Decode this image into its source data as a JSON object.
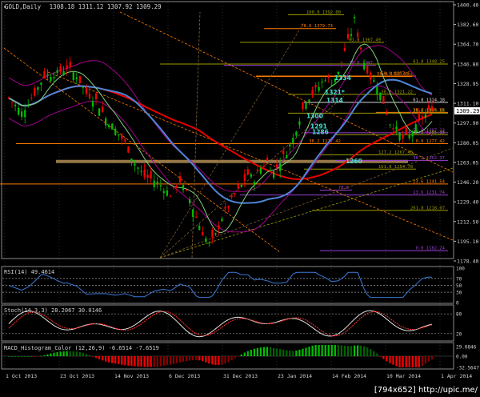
{
  "header": {
    "symbol": "GOLD,Daily",
    "ohlc": "1308.18 1311.12 1307.92 1309.29"
  },
  "colors": {
    "bg": "#000000",
    "grid": "#2a2a2a",
    "axis": "#bfbfbf",
    "text": "#d0d0d0",
    "bull": "#00c000",
    "bear": "#ff0000",
    "wick": "#bfbfbf",
    "ma_red": "#e80000",
    "ma_blue": "#4f86d6",
    "ma_green": "#7fd07f",
    "bollinger": "#b0009a",
    "fib_grey": "#d8d8d8",
    "fib_olive": "#9a9a00",
    "fib_violet": "#9b3fd8",
    "fib_orange": "#ff7b00",
    "cyan": "#40e0d0",
    "sr_band": "#c8a060",
    "price_label_bg": "#ffffff"
  },
  "chart_data": {
    "type": "candlestick",
    "price_axis_ticks": [
      "1400.40",
      "1382.60",
      "1364.70",
      "1346.80",
      "1328.95",
      "1311.10",
      "1297.90",
      "1280.05",
      "1263.05",
      "1246.20",
      "1229.40",
      "1212.50",
      "1195.10",
      "1178.40"
    ],
    "current_price": "1309.29",
    "price_range": [
      1176.0,
      1403.0
    ],
    "date_axis_labels": [
      "1 Oct 2013",
      "23 Oct 2013",
      "14 Nov 2013",
      "6 Dec 2013",
      "31 Dec 2013",
      "23 Jan 2014",
      "14 Feb 2014",
      "10 Mar 2014",
      "1 Apr 2014"
    ],
    "bar_count": 132,
    "candles_close_path": [
      [
        0,
        1318
      ],
      [
        4,
        1305
      ],
      [
        8,
        1322
      ],
      [
        11,
        1338
      ],
      [
        15,
        1340
      ],
      [
        18,
        1345
      ],
      [
        21,
        1338
      ],
      [
        24,
        1322
      ],
      [
        27,
        1316
      ],
      [
        30,
        1300
      ],
      [
        33,
        1290
      ],
      [
        36,
        1278
      ],
      [
        39,
        1260
      ],
      [
        42,
        1248
      ],
      [
        45,
        1245
      ],
      [
        48,
        1238
      ],
      [
        50,
        1232
      ],
      [
        53,
        1244
      ],
      [
        56,
        1228
      ],
      [
        58,
        1212
      ],
      [
        60,
        1198
      ],
      [
        62,
        1188
      ],
      [
        64,
        1196
      ],
      [
        66,
        1212
      ],
      [
        68,
        1222
      ],
      [
        70,
        1232
      ],
      [
        72,
        1240
      ],
      [
        74,
        1250
      ],
      [
        76,
        1246
      ],
      [
        78,
        1256
      ],
      [
        80,
        1262
      ],
      [
        82,
        1252
      ],
      [
        84,
        1262
      ],
      [
        86,
        1270
      ],
      [
        88,
        1282
      ],
      [
        90,
        1300
      ],
      [
        92,
        1316
      ],
      [
        94,
        1322
      ],
      [
        96,
        1328
      ],
      [
        98,
        1336
      ],
      [
        100,
        1332
      ],
      [
        102,
        1340
      ],
      [
        104,
        1360
      ],
      [
        106,
        1376
      ],
      [
        107,
        1388
      ],
      [
        108,
        1374
      ],
      [
        110,
        1350
      ],
      [
        112,
        1336
      ],
      [
        114,
        1330
      ],
      [
        116,
        1314
      ],
      [
        118,
        1296
      ],
      [
        120,
        1290
      ],
      [
        122,
        1282
      ],
      [
        124,
        1284
      ],
      [
        126,
        1292
      ],
      [
        128,
        1300
      ],
      [
        130,
        1306
      ],
      [
        131,
        1309.29
      ]
    ],
    "fib_retracements": [
      {
        "label": "100.0",
        "value": "1392.00"
      },
      {
        "label": "78.6",
        "value": "1379.73"
      },
      {
        "label": "61.8",
        "value": "1367.49"
      },
      {
        "label": "78.6",
        "value": "1347"
      },
      {
        "label": "61.8",
        "value": "1348.25"
      },
      {
        "label": "50.0",
        "value": "1337.52"
      },
      {
        "label": "50.0",
        "value": "1337.05"
      },
      {
        "label": "38.2",
        "value": "1321.22"
      },
      {
        "label": "61.8",
        "value": "1314.18"
      },
      {
        "label": "38.2",
        "value": "1305.25"
      },
      {
        "label": "23.6",
        "value": "1304.50"
      },
      {
        "label": "50.0",
        "value": "1287.13"
      },
      {
        "label": "38.2",
        "value": "1285.33"
      },
      {
        "label": "38.2",
        "value": "1277.42"
      },
      {
        "label": "0.0",
        "value": "1277.42"
      },
      {
        "label": "127.2",
        "value": "1267.48"
      },
      {
        "label": "38.2",
        "value": "1262.37"
      },
      {
        "label": "161.8",
        "value": "1254.78"
      },
      {
        "label": "23.6",
        "value": "1241.54"
      },
      {
        "label": "23.6",
        "value": "1231.74"
      },
      {
        "label": "78.6",
        "value": ""
      },
      {
        "label": "261.8",
        "value": "1218.07"
      },
      {
        "label": "0.0",
        "value": "1182.24"
      }
    ],
    "sr_labels": [
      {
        "text": "1334",
        "value": 1334
      },
      {
        "text": "1321*",
        "value": 1321
      },
      {
        "text": "1314",
        "value": 1314
      },
      {
        "text": "1300",
        "value": 1300
      },
      {
        "text": "1291",
        "value": 1291
      },
      {
        "text": "1286",
        "value": 1286
      },
      {
        "text": "1260",
        "value": 1260
      }
    ],
    "rsi": {
      "label": "RSI(14) 49.4614",
      "levels": [
        "100",
        "70",
        "50",
        "30",
        "0"
      ]
    },
    "stoch": {
      "label": "Stoch(14,3,3) 28.2067 30.0146",
      "levels": [
        "80",
        "20"
      ]
    },
    "macd": {
      "label": "MACD_Histogram_Color (12,26,9) -6.6514 -7.6519",
      "levels": [
        "29.0846",
        "0.00",
        "-32.5647"
      ]
    }
  },
  "watermark": "[794x652] http://upic.me/"
}
